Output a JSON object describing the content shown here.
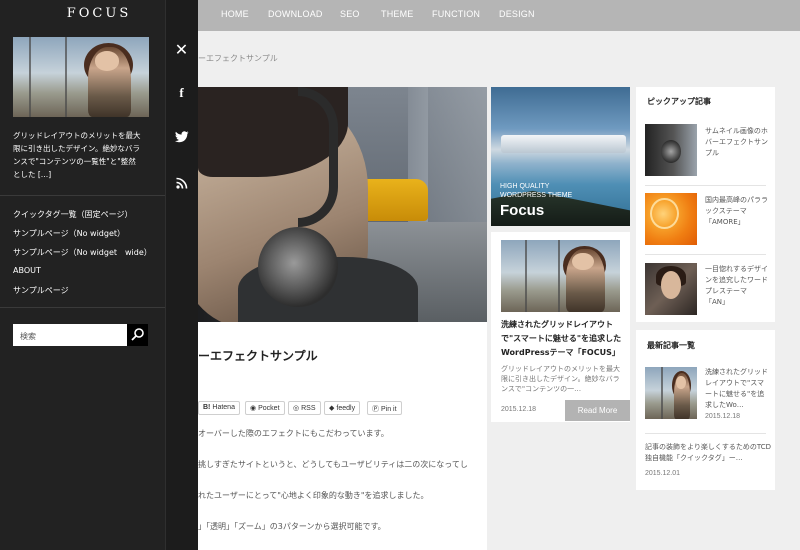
{
  "nav": {
    "items": [
      "HOME",
      "DOWNLOAD",
      "SEO",
      "THEME",
      "FUNCTION",
      "DESIGN"
    ]
  },
  "breadcrumb": "ーエフェクトサンプル",
  "article": {
    "title": "ーエフェクトサンプル",
    "share": [
      "Hatena",
      "Pocket",
      "RSS",
      "feedly",
      "Pin it"
    ],
    "share_icons": [
      "B!",
      "pocket-icon",
      "rss-icon",
      "feedly-icon",
      "pinterest-icon"
    ],
    "body": [
      "オーバーした際のエフェクトにもこだわっています。",
      "挑しすぎたサイトというと、どうしてもユーザビリティは二の次になってし",
      "れたユーザーにとって\"心地よく印象的な動き\"を追求しました。",
      "」「透明」「ズーム」の3パターンから選択可能です。"
    ]
  },
  "banner": {
    "line1": "HIGH QUALITY",
    "line2": "WORDPRESS THEME",
    "title": "Focus"
  },
  "card": {
    "title": [
      "洗練されたグリッドレイアウト",
      "で\"スマートに魅せる\"を追求した",
      "WordPressテーマ「FOCUS」"
    ],
    "excerpt": [
      "グリッドレイアウトのメリットを最大",
      "限に引き出したデザイン。絶妙なバラ",
      "ンスで\"コンテンツの一…"
    ],
    "date": "2015.12.18",
    "readmore": "Read More"
  },
  "pickup": {
    "title": "ピックアップ記事",
    "items": [
      [
        "サムネイル画像のホ",
        "バーエフェクトサン",
        "プル"
      ],
      [
        "国内最高峰のパララ",
        "ックステーマ",
        "「AMORE」"
      ],
      [
        "一目惚れするデザイ",
        "ンを追究したワード",
        "プレステーマ",
        "「AN」"
      ]
    ]
  },
  "recent": {
    "title": "最新記事一覧",
    "item1": [
      "洗練されたグリッド",
      "レイアウトで\"スマ",
      "ートに魅せる\"を追",
      "求したWo…"
    ],
    "item1_date": "2015.12.18",
    "item2": [
      "記事の装飾をより楽しくするためのTCD",
      "独自機能「クイックタグ」ー…"
    ],
    "item2_date": "2015.12.01"
  },
  "drawer": {
    "logo": "FOCUS",
    "text": [
      "グリッドレイアウトのメリットを最大",
      "限に引き出したデザイン。絶妙なバラ",
      "ンスで\"コンテンツの一覧性\"と\"整然",
      "とした […]"
    ],
    "menu": [
      "クイックタグ一覧（固定ページ）",
      "サンプルページ（No widget）",
      "サンプルページ（No widget　wide）",
      "ABOUT",
      "サンプルページ"
    ],
    "search_placeholder": "検索"
  },
  "icons": {
    "close": "close-icon",
    "facebook": "facebook-icon",
    "twitter": "twitter-icon",
    "rss": "rss-icon",
    "search": "search-icon"
  }
}
